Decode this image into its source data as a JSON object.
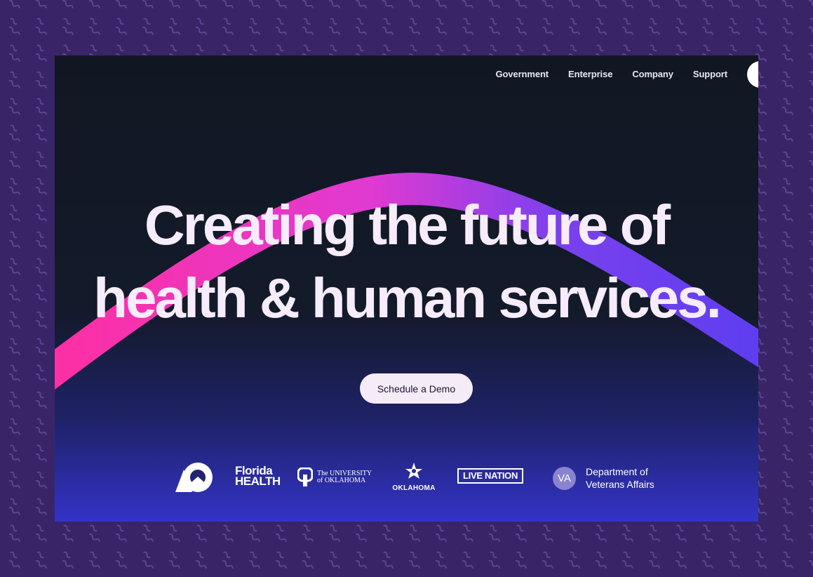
{
  "nav": {
    "items": [
      {
        "label": "Government"
      },
      {
        "label": "Enterprise"
      },
      {
        "label": "Company"
      },
      {
        "label": "Support"
      }
    ]
  },
  "hero": {
    "headline_line1": "Creating the future of",
    "headline_line2": "health & human services.",
    "cta_label": "Schedule a Demo"
  },
  "logos": {
    "florida_line1": "Florida",
    "florida_line2": "HEALTH",
    "ou_line1": "The UNIVERSITY",
    "ou_line2": "of OKLAHOMA",
    "oklahoma": "OKLAHOMA",
    "live_nation": "LIVE NATION",
    "va_badge": "VA",
    "va_line1": "Department of",
    "va_line2": "Veterans Affairs"
  },
  "colors": {
    "background": "#3a2468",
    "arc_start": "#ff2fa0",
    "arc_end": "#5a3ef0",
    "cta_bg": "#f5ecf8"
  }
}
